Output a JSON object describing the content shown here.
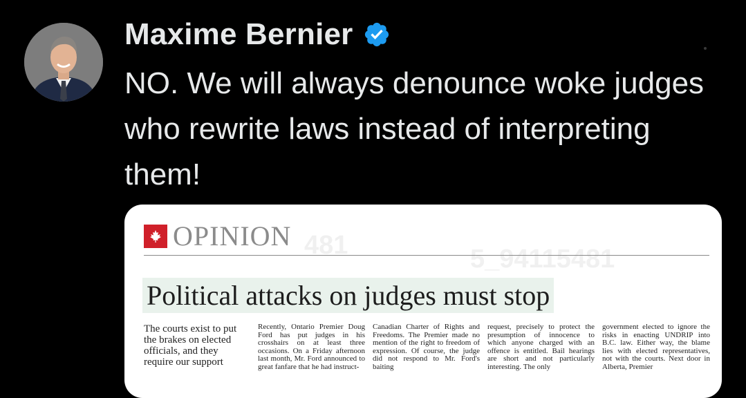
{
  "tweet": {
    "author_name": "Maxime Bernier",
    "verified_icon": "verified-badge-icon",
    "text": "NO. We will always denounce woke judges who rewrite laws instead of interpreting them!"
  },
  "article": {
    "section": "OPINION",
    "headline": "Political attacks on judges must stop",
    "deck": "The courts exist to put the brakes on elected officials, and they require our support",
    "columns": [
      "Recently, Ontario Premier Doug Ford has put judges in his crosshairs on at least three occasions. On a Friday afternoon last month, Mr. Ford announced to great fanfare that he had instruct-",
      "Canadian Charter of Rights and Freedoms. The Premier made no mention of the right to freedom of expression. Of course, the judge did not respond to Mr. Ford's baiting",
      "request, precisely to protect the presumption of innocence to which anyone charged with an offence is entitled. Bail hearings are short and not particularly interesting. The only",
      "government elected to ignore the risks in enacting UNDRIP into B.C. law. Either way, the blame lies with elected representatives, not with the courts. Next door in Alberta, Premier"
    ],
    "watermarks": [
      "481",
      "5_94115481"
    ]
  },
  "colors": {
    "background": "#000000",
    "text": "#e7e9ea",
    "verified_blue": "#1d9bf0",
    "globe_red": "#d0202a",
    "headline_highlight": "#e9f2ec"
  }
}
